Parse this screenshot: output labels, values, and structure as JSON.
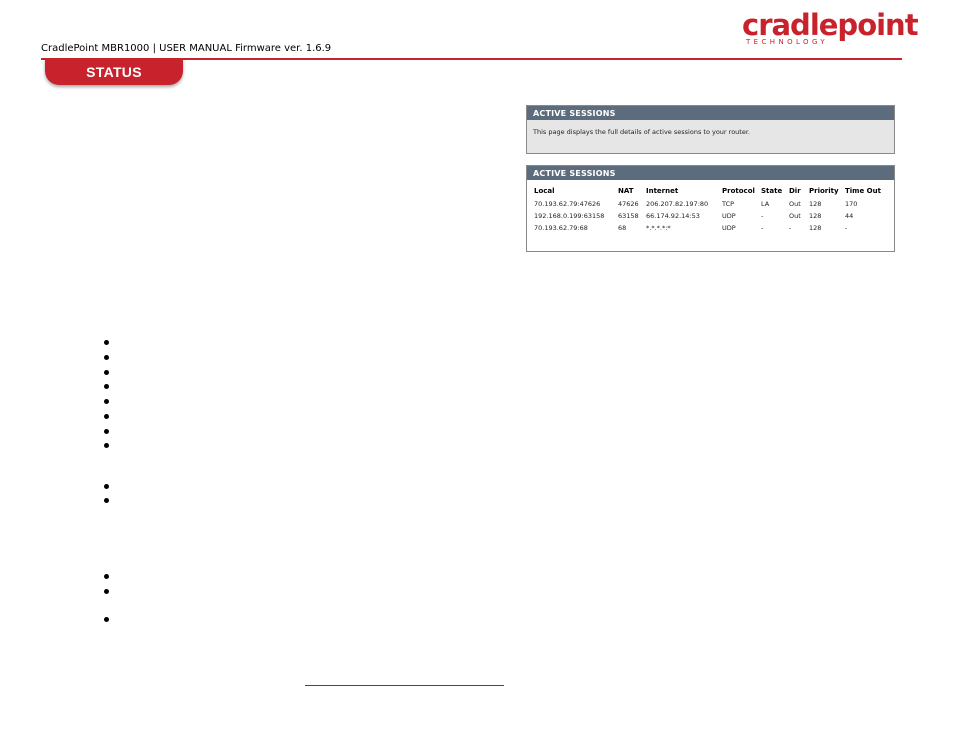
{
  "header": {
    "title": "CradlePoint MBR1000 | USER MANUAL Firmware ver. 1.6.9",
    "logo_word": "cradlepoint",
    "logo_sub": "TECHNOLOGY",
    "section_tab": "STATUS",
    "brand_color": "#c8232c"
  },
  "info_panel": {
    "heading": "ACTIVE SESSIONS",
    "text": "This page displays the full details of active sessions to your router."
  },
  "sessions_panel": {
    "heading": "ACTIVE SESSIONS",
    "columns": [
      "Local",
      "NAT",
      "Internet",
      "Protocol",
      "State",
      "Dir",
      "Priority",
      "Time Out"
    ],
    "rows": [
      [
        "70.193.62.79:47626",
        "47626",
        "206.207.82.197:80",
        "TCP",
        "LA",
        "Out",
        "128",
        "170"
      ],
      [
        "192.168.0.199:63158",
        "63158",
        "66.174.92.14:53",
        "UDP",
        "-",
        "Out",
        "128",
        "44"
      ],
      [
        "70.193.62.79:68",
        "68",
        "*.*.*.*:*",
        "UDP",
        "-",
        "-",
        "128",
        "-"
      ]
    ]
  },
  "colors": {
    "panel_header": "#5c6c7c",
    "panel_body": "#e6e6e6",
    "link": "#1a4fb0"
  }
}
